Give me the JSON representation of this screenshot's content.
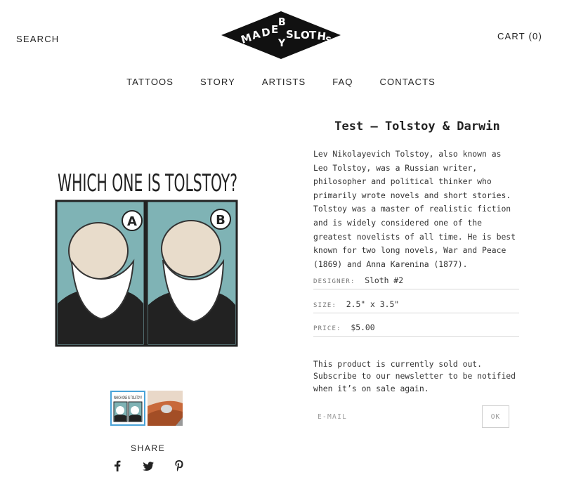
{
  "header": {
    "search_label": "SEARCH",
    "cart_label": "CART (0)",
    "logo_text_top": "MADE BY SLOTHS",
    "logo_letters": [
      "M",
      "A",
      "D",
      "E",
      "B",
      "Y",
      "S",
      "L",
      "O",
      "T",
      "H",
      "S"
    ]
  },
  "nav": {
    "items": [
      {
        "label": "TATTOOS"
      },
      {
        "label": "STORY"
      },
      {
        "label": "ARTISTS"
      },
      {
        "label": "FAQ"
      },
      {
        "label": "CONTACTS"
      }
    ]
  },
  "gallery": {
    "main_image_caption": "WHICH ONE IS TOLSTOY?",
    "panel_a_label": "A",
    "panel_b_label": "B",
    "thumbnails": [
      {
        "name": "thumbnail-tolstoy-darwin",
        "active": true,
        "caption": "WHICH ONE IS TOLSTOY?"
      },
      {
        "name": "thumbnail-tattoo-photo",
        "active": false
      }
    ]
  },
  "share": {
    "title": "SHARE",
    "icons": [
      "facebook-icon",
      "twitter-icon",
      "pinterest-icon"
    ]
  },
  "product": {
    "title": "Test — Tolstoy & Darwin",
    "description": "Lev Nikolayevich Tolstoy, also known as Leo Tolstoy, was a Russian writer, philosopher and political thinker who primarily wrote novels and short stories. Tolstoy was a master of realistic fiction and is widely considered one of the greatest novelists of all time. He is best known for two long novels, War and Peace (1869) and Anna Karenina (1877).",
    "specs": [
      {
        "key": "DESIGNER:",
        "value": "Sloth #2"
      },
      {
        "key": "SIZE:",
        "value": "2.5\" x 3.5\""
      },
      {
        "key": "PRICE:",
        "value": "$5.00"
      }
    ],
    "sold_out_text": "This product is currently sold out. Subscribe to our newsletter to be notified when it’s on sale again.",
    "email_placeholder": "E-MAIL",
    "ok_label": "OK"
  },
  "colors": {
    "panel_bg": "#7fb3b5",
    "thumb_active_border": "#4aa3d8",
    "text": "#222222"
  }
}
